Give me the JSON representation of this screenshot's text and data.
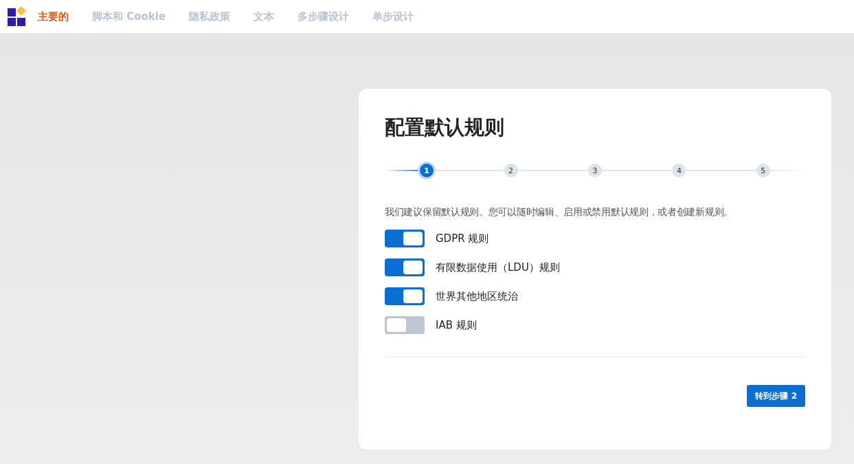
{
  "nav": {
    "tabs": [
      {
        "label": "主要的",
        "selected": true
      },
      {
        "label": "脚本和 Cookie",
        "selected": false
      },
      {
        "label": "隐私政策",
        "selected": false
      },
      {
        "label": "文本",
        "selected": false
      },
      {
        "label": "多步骤设计",
        "selected": false
      },
      {
        "label": "单步设计",
        "selected": false
      }
    ]
  },
  "card": {
    "title": "配置默认规则",
    "steps": [
      {
        "label": "1",
        "selected": true
      },
      {
        "label": "2",
        "selected": false
      },
      {
        "label": "3",
        "selected": false
      },
      {
        "label": "4",
        "selected": false
      },
      {
        "label": "5",
        "selected": false
      }
    ],
    "description": "我们建议保留默认规则。您可以随时编辑、启用或禁用默认规则，或者创建新规则。",
    "rules": [
      {
        "label": "GDPR 规则",
        "on": true
      },
      {
        "label": "有限数据使用（LDU）规则",
        "on": true
      },
      {
        "label": "世界其他地区统治",
        "on": true
      },
      {
        "label": "IAB 规则",
        "on": false
      }
    ],
    "next_button": "转到步骤 2"
  }
}
